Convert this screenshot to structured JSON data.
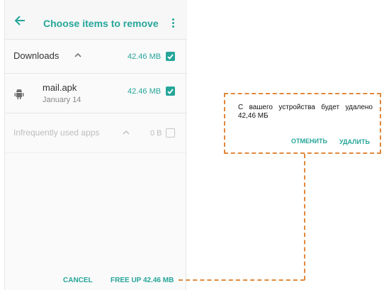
{
  "header": {
    "title": "Choose items to remove",
    "back_icon": "arrow-left-icon",
    "menu_icon": "more-vert-icon"
  },
  "downloads": {
    "label": "Downloads",
    "size": "42.46 MB",
    "expand_icon": "chevron-up-icon",
    "checked": true
  },
  "apk_item": {
    "name": "mail.apk",
    "date": "January 14",
    "size": "42.46 MB",
    "icon": "android-icon",
    "checked": true
  },
  "infrequent": {
    "label": "Infrequently used apps",
    "size": "0 B",
    "expand_icon": "chevron-up-icon",
    "checked": false
  },
  "footer": {
    "cancel_label": "CANCEL",
    "free_up_label": "FREE UP 42.46 MB"
  },
  "dialog": {
    "message": "С вашего устройства будет удалено 42,46 МБ",
    "cancel_label": "ОТМЕНИТЬ",
    "delete_label": "УДАЛИТЬ"
  },
  "colors": {
    "accent": "#26a69a",
    "callout_border": "#e0893d",
    "disabled_text": "#bdbdbd"
  }
}
